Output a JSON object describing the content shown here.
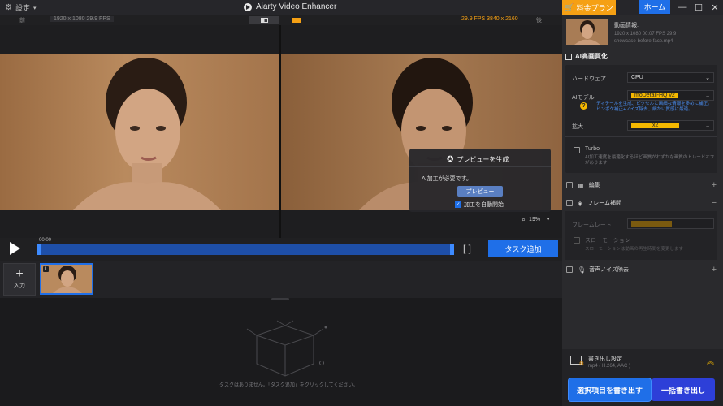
{
  "titlebar": {
    "settings_label": "設定",
    "app_title": "Aiarty Video Enhancer"
  },
  "window": {
    "plan_label": "料金プラン",
    "home_label": "ホーム",
    "minimize": "—",
    "maximize": "☐",
    "close": "✕"
  },
  "compare": {
    "before_label": "前",
    "after_label": "後",
    "before_info": "1920 x 1080   29.9 FPS",
    "after_info": "29.9 FPS   3840 x 2160"
  },
  "preview": {
    "title": "プレビューを生成",
    "message": "AI加工が必要です。",
    "button_label": "プレビュー",
    "auto_label": "加工を自動開始"
  },
  "zoom": {
    "value": "19%"
  },
  "timeline": {
    "time": "00:00",
    "brackets": "[   ]",
    "add_task_label": "タスク追加"
  },
  "thumbs": {
    "add_label": "入力"
  },
  "queue": {
    "empty_text": "タスクはありません。「タスク追加」をクリックしてください。"
  },
  "info": {
    "label": "動画情報:",
    "specs": "1920 x 1080   00:07   FPS 29.9",
    "filename": "showcase-before-face.mp4"
  },
  "ai": {
    "section_title": "AI高画質化",
    "hardware_label": "ハードウェア",
    "hardware_value": "CPU",
    "model_label": "AIモデル",
    "model_value": "moDetail-HQ  v2",
    "model_desc": "ディテールを生成、ピクセルと画細な情報を多めに補正。ビンボケ補正+ノイズ除去、細かい質感に最適。",
    "scale_label": "拡大",
    "scale_value": "x2",
    "turbo_label": "Turbo",
    "turbo_desc": "AI加工速度を最適化するほど画質がわずかな画質のトレードオフがあります"
  },
  "sections": {
    "edit_label": "編集",
    "frame_label": "フレーム補間",
    "frame_rate_label": "フレームレート",
    "slowmo_label": "スローモーション",
    "slowmo_desc": "スローモーションは動画の再生時間を変更します",
    "denoise_label": "音声ノイズ除去"
  },
  "export": {
    "title": "書き出し設定",
    "format": "mp4 ( H.264, AAC )",
    "export_selected_label": "選択項目を書き出す",
    "export_all_label": "一括書き出し"
  },
  "colors": {
    "accent_blue": "#1f6fe8",
    "accent_orange": "#f5a014",
    "model_yellow": "#f5b800"
  }
}
